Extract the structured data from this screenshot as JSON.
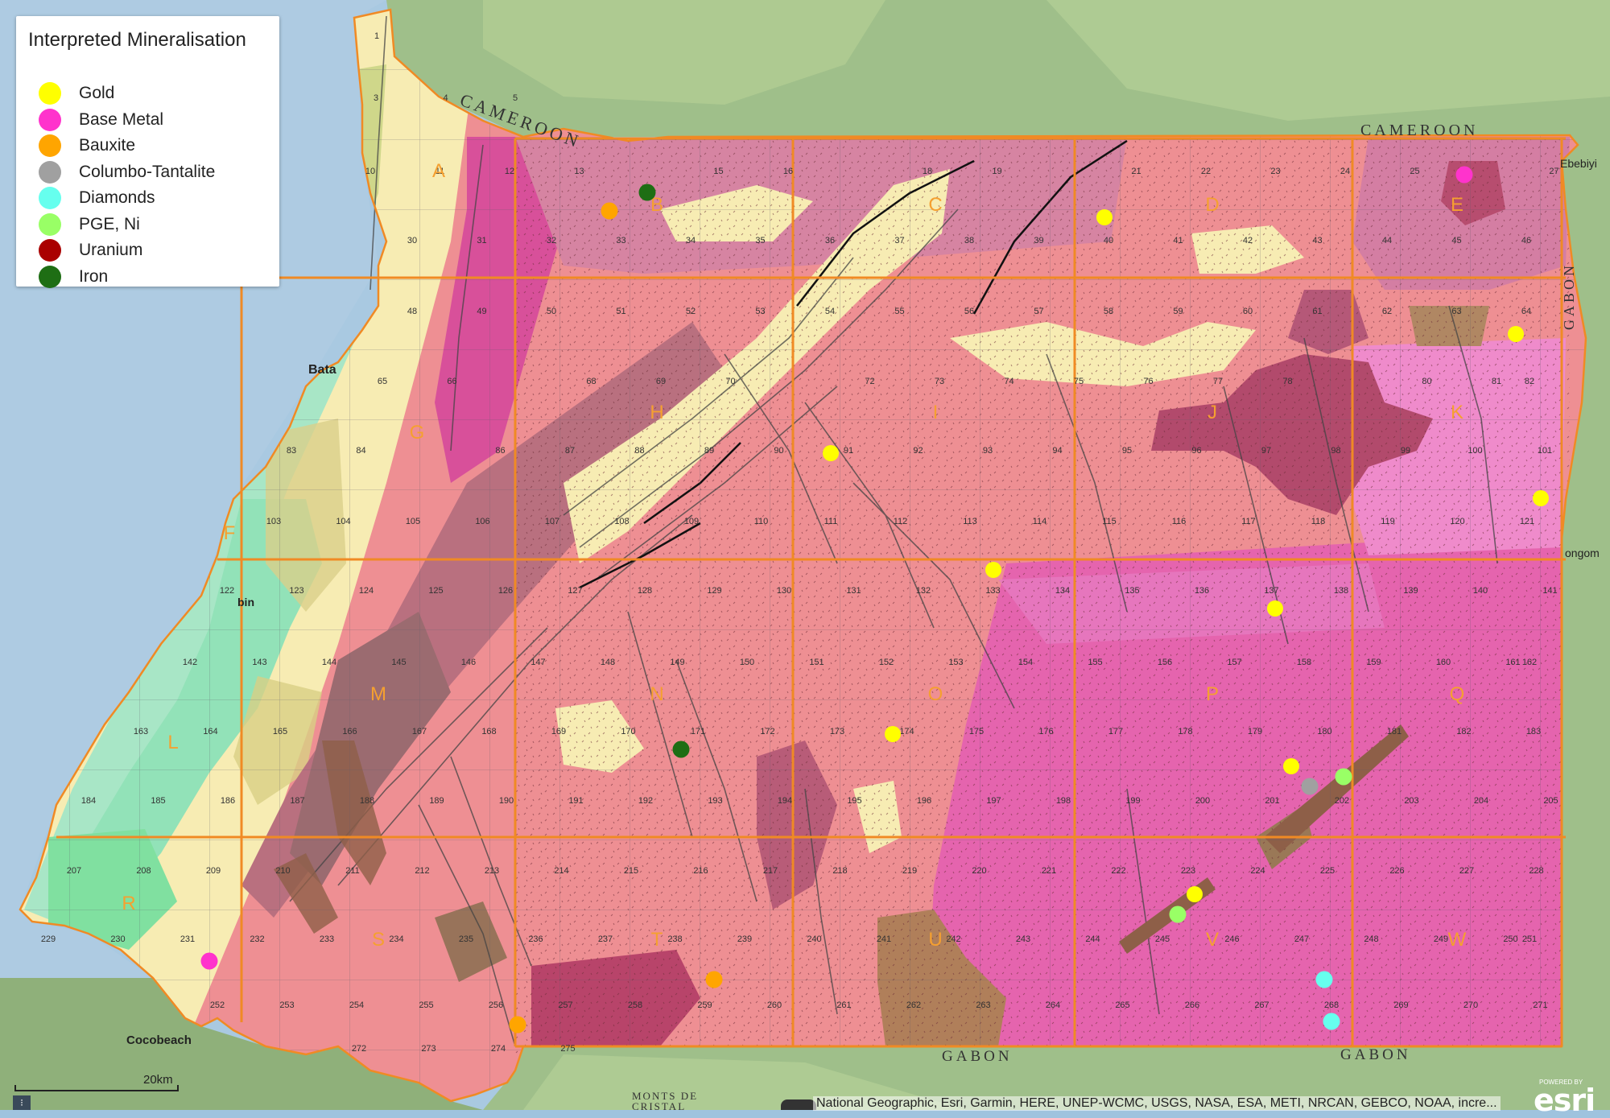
{
  "legend": {
    "title": "Interpreted Mineralisation",
    "items": [
      {
        "label": "Gold",
        "color": "#ffff00"
      },
      {
        "label": "Base Metal",
        "color": "#ff33cc"
      },
      {
        "label": "Bauxite",
        "color": "#ffa500"
      },
      {
        "label": "Columbo-Tantalite",
        "color": "#a0a0a0"
      },
      {
        "label": "Diamonds",
        "color": "#66ffee"
      },
      {
        "label": "PGE, Ni",
        "color": "#99ff66"
      },
      {
        "label": "Uranium",
        "color": "#aa0000"
      },
      {
        "label": "Iron",
        "color": "#1e6e14"
      }
    ]
  },
  "places": {
    "cameroon_1": "CAMEROON",
    "cameroon_2": "CAMEROON",
    "gabon_1": "GABON",
    "gabon_2": "GABON",
    "gabon_east": "GABON",
    "bata": "Bata",
    "cocobeach": "Cocobeach",
    "ebebiyin": "Ebebiyi",
    "mongomo": "ongom",
    "monts_de_cristal_1": "MONTS DE",
    "monts_de_cristal_2": "CRISTAL",
    "bin": "bin"
  },
  "blocks": [
    {
      "id": "A"
    },
    {
      "id": "B"
    },
    {
      "id": "C"
    },
    {
      "id": "D"
    },
    {
      "id": "E"
    },
    {
      "id": "F"
    },
    {
      "id": "G"
    },
    {
      "id": "H"
    },
    {
      "id": "I"
    },
    {
      "id": "J"
    },
    {
      "id": "K"
    },
    {
      "id": "L"
    },
    {
      "id": "M"
    },
    {
      "id": "N"
    },
    {
      "id": "O"
    },
    {
      "id": "P"
    },
    {
      "id": "Q"
    },
    {
      "id": "R"
    },
    {
      "id": "S"
    },
    {
      "id": "T"
    },
    {
      "id": "U"
    },
    {
      "id": "V"
    },
    {
      "id": "W"
    }
  ],
  "cell_labels": [
    "1",
    "3",
    "4",
    "5",
    "10",
    "11",
    "12",
    "13",
    "15",
    "16",
    "18",
    "19",
    "21",
    "22",
    "23",
    "24",
    "25",
    "27",
    "30",
    "31",
    "32",
    "33",
    "34",
    "35",
    "36",
    "37",
    "38",
    "39",
    "40",
    "41",
    "42",
    "43",
    "44",
    "45",
    "46",
    "48",
    "49",
    "50",
    "51",
    "52",
    "53",
    "54",
    "55",
    "56",
    "57",
    "58",
    "59",
    "60",
    "61",
    "62",
    "63",
    "64",
    "65",
    "66",
    "68",
    "69",
    "70",
    "72",
    "73",
    "74",
    "75",
    "76",
    "77",
    "78",
    "80",
    "81",
    "82",
    "83",
    "84",
    "86",
    "87",
    "88",
    "89",
    "90",
    "91",
    "92",
    "93",
    "94",
    "95",
    "96",
    "97",
    "98",
    "99",
    "100",
    "101",
    "103",
    "104",
    "105",
    "106",
    "107",
    "108",
    "109",
    "110",
    "111",
    "112",
    "113",
    "114",
    "115",
    "116",
    "117",
    "118",
    "119",
    "120",
    "121",
    "122",
    "123",
    "124",
    "125",
    "126",
    "127",
    "128",
    "129",
    "130",
    "131",
    "132",
    "133",
    "134",
    "135",
    "136",
    "137",
    "138",
    "139",
    "140",
    "141",
    "142",
    "143",
    "144",
    "145",
    "146",
    "147",
    "148",
    "149",
    "150",
    "151",
    "152",
    "153",
    "154",
    "155",
    "156",
    "157",
    "158",
    "159",
    "160",
    "161",
    "162",
    "163",
    "164",
    "165",
    "166",
    "167",
    "168",
    "169",
    "170",
    "171",
    "172",
    "173",
    "174",
    "175",
    "176",
    "177",
    "178",
    "179",
    "180",
    "181",
    "182",
    "183",
    "184",
    "185",
    "186",
    "187",
    "188",
    "189",
    "190",
    "191",
    "192",
    "193",
    "194",
    "195",
    "196",
    "197",
    "198",
    "199",
    "200",
    "201",
    "202",
    "203",
    "204",
    "205",
    "207",
    "208",
    "209",
    "210",
    "211",
    "212",
    "213",
    "214",
    "215",
    "216",
    "217",
    "218",
    "219",
    "220",
    "221",
    "222",
    "223",
    "224",
    "225",
    "226",
    "227",
    "228",
    "229",
    "230",
    "231",
    "232",
    "233",
    "234",
    "235",
    "236",
    "237",
    "238",
    "239",
    "240",
    "241",
    "242",
    "243",
    "244",
    "245",
    "246",
    "247",
    "248",
    "249",
    "250",
    "251",
    "252",
    "253",
    "254",
    "255",
    "256",
    "257",
    "258",
    "259",
    "260",
    "261",
    "262",
    "263",
    "264",
    "265",
    "266",
    "267",
    "268",
    "269",
    "270",
    "271",
    "272",
    "273",
    "274",
    "275"
  ],
  "occurrences": [
    {
      "type": "Gold",
      "cell": "40"
    },
    {
      "type": "Gold",
      "cell": "64"
    },
    {
      "type": "Gold",
      "cell": "91"
    },
    {
      "type": "Gold",
      "cell": "121"
    },
    {
      "type": "Gold",
      "cell": "133"
    },
    {
      "type": "Gold",
      "cell": "137"
    },
    {
      "type": "Gold",
      "cell": "174"
    },
    {
      "type": "Gold",
      "cell": "180"
    },
    {
      "type": "Gold",
      "cell": "225"
    },
    {
      "type": "Base Metal",
      "cell": "26"
    },
    {
      "type": "Base Metal",
      "cell": "232"
    },
    {
      "type": "Bauxite",
      "cell": "33"
    },
    {
      "type": "Bauxite",
      "cell": "258"
    },
    {
      "type": "Bauxite",
      "cell": "256"
    },
    {
      "type": "Columbo-Tantalite",
      "cell": "202"
    },
    {
      "type": "Diamonds",
      "cell": "248"
    },
    {
      "type": "Diamonds",
      "cell": "268"
    },
    {
      "type": "PGE, Ni",
      "cell": "203"
    },
    {
      "type": "PGE, Ni",
      "cell": "246"
    },
    {
      "type": "Iron",
      "cell": "14"
    },
    {
      "type": "Iron",
      "cell": "171"
    }
  ],
  "scale": {
    "label": "20km"
  },
  "attribution": "National Geographic, Esri, Garmin, HERE, UNEP-WCMC, USGS, NASA, ESA, METI, NRCAN, GEBCO, NOAA, incre...",
  "powered_by": "POWERED BY",
  "brand": "esri"
}
